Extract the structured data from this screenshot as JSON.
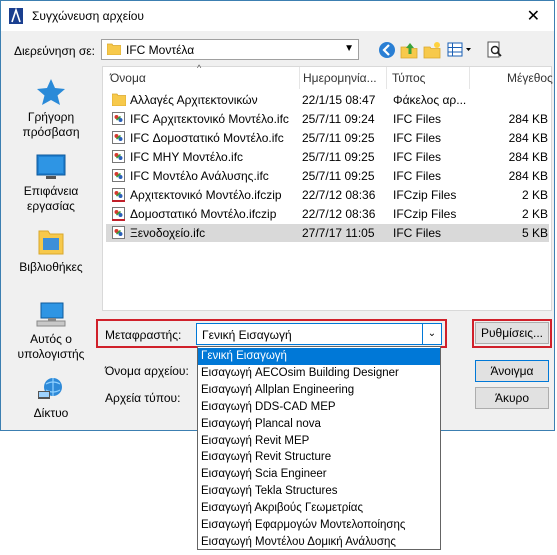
{
  "window": {
    "title": "Συγχώνευση αρχείου"
  },
  "lookin": {
    "label": "Διερεύνηση σε:",
    "value": "IFC Μοντέλα"
  },
  "places": [
    {
      "label": "Γρήγορη πρόσβαση",
      "icon": "quick-access-star-icon"
    },
    {
      "label": "Επιφάνεια εργασίας",
      "icon": "desktop-icon"
    },
    {
      "label": "Βιβλιοθήκες",
      "icon": "libraries-icon"
    },
    {
      "label": "Αυτός ο υπολογιστής",
      "icon": "this-pc-icon"
    },
    {
      "label": "Δίκτυο",
      "icon": "network-icon"
    }
  ],
  "columns": {
    "name": "Όνομα",
    "date": "Ημερομηνία...",
    "type": "Τύπος",
    "size": "Μέγεθος"
  },
  "files": [
    {
      "name": "Αλλαγές Αρχιτεκτονικών",
      "date": "22/1/15 08:47",
      "type": "Φάκελος αρ...",
      "size": "",
      "icon": "folder"
    },
    {
      "name": "IFC Αρχιτεκτονικό Μοντέλο.ifc",
      "date": "25/7/11 09:24",
      "type": "IFC Files",
      "size": "284 KB",
      "icon": "ifc"
    },
    {
      "name": "IFC Δομοστατικό Μοντέλο.ifc",
      "date": "25/7/11 09:25",
      "type": "IFC Files",
      "size": "284 KB",
      "icon": "ifc"
    },
    {
      "name": "IFC MHY Μοντέλο.ifc",
      "date": "25/7/11 09:25",
      "type": "IFC Files",
      "size": "284 KB",
      "icon": "ifc"
    },
    {
      "name": "IFC Μοντέλο Ανάλυσης.ifc",
      "date": "25/7/11 09:25",
      "type": "IFC Files",
      "size": "284 KB",
      "icon": "ifc"
    },
    {
      "name": "Αρχιτεκτονικό Μοντέλο.ifczip",
      "date": "22/7/12 08:36",
      "type": "IFCzip Files",
      "size": "2 KB",
      "icon": "ifczip"
    },
    {
      "name": "Δομοστατικό Μοντέλο.ifczip",
      "date": "22/7/12 08:36",
      "type": "IFCzip Files",
      "size": "2 KB",
      "icon": "ifczip"
    },
    {
      "name": "Ξενοδοχείο.ifc",
      "date": "27/7/17 11:05",
      "type": "IFC Files",
      "size": "5 KB",
      "icon": "ifc",
      "selected": true
    }
  ],
  "translator": {
    "label": "Μεταφραστής:",
    "value": "Γενική Εισαγωγή",
    "settings_label": "Ρυθμίσεις...",
    "options": [
      "Γενική Εισαγωγή",
      "Εισαγωγή AECOsim Building Designer",
      "Εισαγωγή Allplan Engineering",
      "Εισαγωγή DDS-CAD MEP",
      "Εισαγωγή Plancal nova",
      "Εισαγωγή Revit MEP",
      "Εισαγωγή Revit Structure",
      "Εισαγωγή Scia Engineer",
      "Εισαγωγή Tekla Structures",
      "Εισαγωγή Ακριβούς Γεωμετρίας",
      "Εισαγωγή Εφαρμογών Μοντελοποίησης",
      "Εισαγωγή Μοντέλου Δομική Ανάλυσης"
    ]
  },
  "filename": {
    "label": "Όνομα αρχείου:"
  },
  "filetype": {
    "label": "Αρχεία τύπου:"
  },
  "buttons": {
    "open": "Άνοιγμα",
    "cancel": "Άκυρο"
  }
}
